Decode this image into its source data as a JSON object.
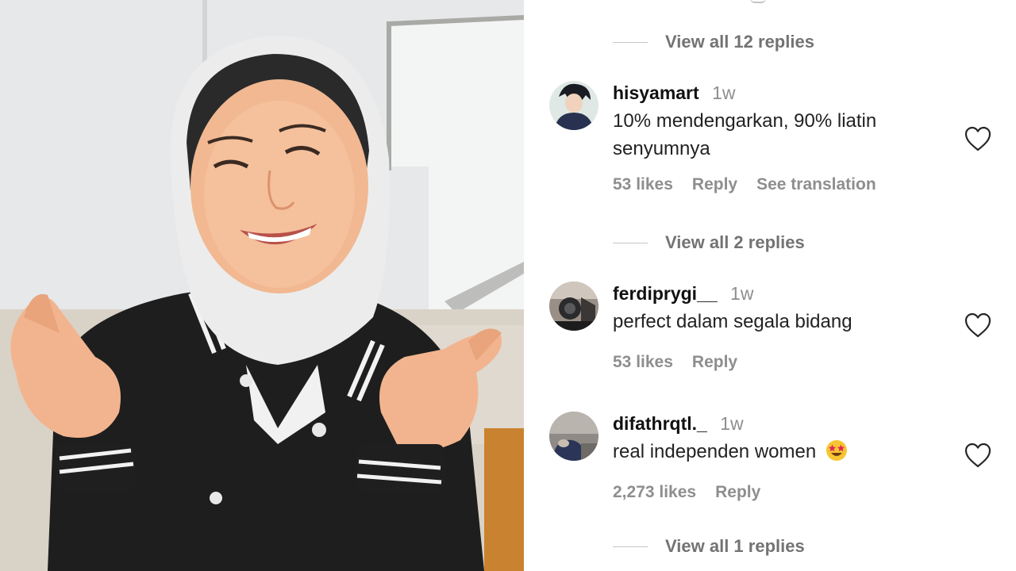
{
  "photo": {
    "description_icon": "woman-finger-heart-photo"
  },
  "thread": {
    "view_replies_top": "View all 12 replies"
  },
  "comments": [
    {
      "username": "hisyamart",
      "time": "1w",
      "text": "10% mendengarkan, 90% liatin senyumnya",
      "likes": "53 likes",
      "reply": "Reply",
      "translate": "See translation",
      "view_replies": "View all 2 replies"
    },
    {
      "username": "ferdiprygi__",
      "time": "1w",
      "text": "perfect dalam segala bidang",
      "likes": "53 likes",
      "reply": "Reply"
    },
    {
      "username": "difathrqtl._",
      "time": "1w",
      "text": "real independen women",
      "emoji": "star-struck-emoji",
      "likes": "2,273 likes",
      "reply": "Reply",
      "view_replies": "View all 1 replies"
    }
  ],
  "icons": {
    "like": "heart-outline-icon"
  },
  "colors": {
    "secondary_text": "#8e8e8e",
    "primary_text": "#111111"
  }
}
